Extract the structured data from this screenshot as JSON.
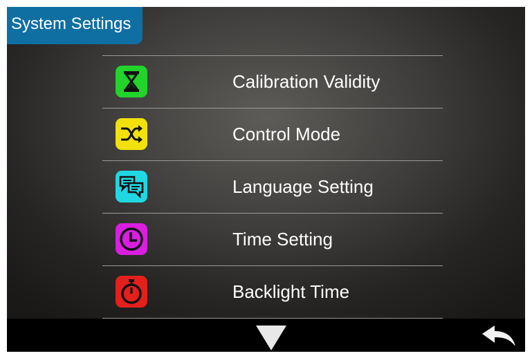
{
  "header": {
    "title": "System Settings"
  },
  "menu": {
    "items": [
      {
        "label": "Calibration Validity",
        "icon": "hourglass-icon",
        "color": "#22d42a"
      },
      {
        "label": "Control Mode",
        "icon": "shuffle-icon",
        "color": "#f2e10c"
      },
      {
        "label": "Language Setting",
        "icon": "speech-bubbles-icon",
        "color": "#1fd8e3"
      },
      {
        "label": "Time Setting",
        "icon": "clock-icon",
        "color": "#d91ee0"
      },
      {
        "label": "Backlight Time",
        "icon": "stopwatch-icon",
        "color": "#e3201b"
      }
    ]
  },
  "footer": {
    "down_icon": "down-triangle-icon",
    "back_icon": "back-arrow-icon"
  }
}
